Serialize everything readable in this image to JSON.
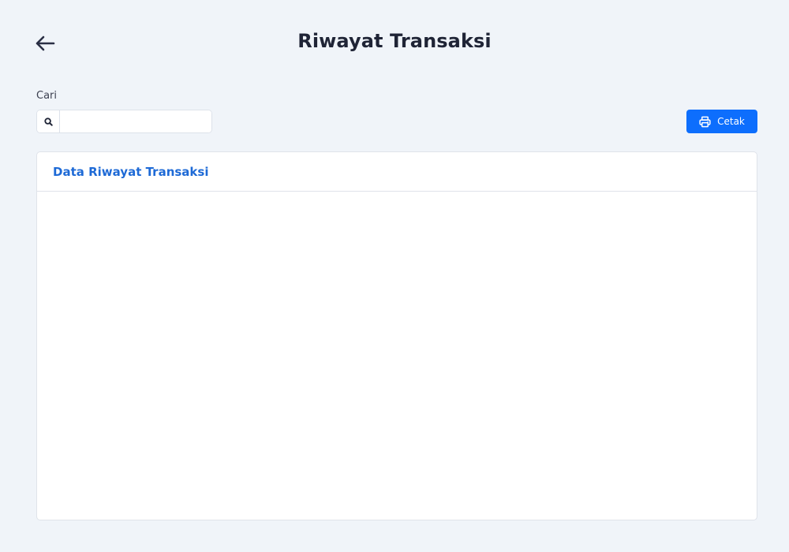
{
  "header": {
    "title": "Riwayat Transaksi",
    "back_icon": "arrow-left-icon"
  },
  "search": {
    "label": "Cari",
    "value": "",
    "placeholder": "",
    "icon": "search-icon"
  },
  "toolbar": {
    "print_label": "Cetak",
    "print_icon": "printer-icon"
  },
  "card": {
    "title": "Data Riwayat Transaksi",
    "rows": []
  },
  "colors": {
    "background": "#f0f4f9",
    "primary": "#0d6efd",
    "card_title": "#1e6ad6",
    "text": "#1f2436"
  }
}
